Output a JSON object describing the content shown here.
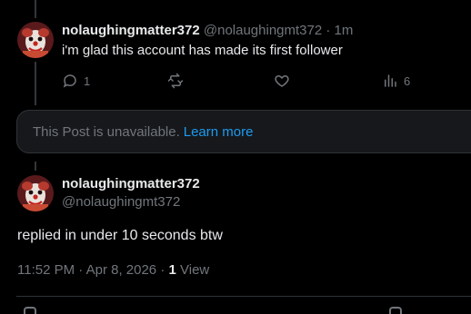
{
  "reply_tweet": {
    "display_name": "nolaughingmatter372",
    "handle": "@nolaughingmt372",
    "separator": "·",
    "time": "1m",
    "text": "i'm glad this account has made its first follower",
    "actions": {
      "reply": {
        "icon": "reply-icon",
        "count": "1"
      },
      "retweet": {
        "icon": "retweet-icon",
        "count": ""
      },
      "like": {
        "icon": "heart-icon",
        "count": ""
      },
      "views": {
        "icon": "views-chart-icon",
        "count": "6"
      }
    }
  },
  "quoted_post": {
    "message": "This Post is unavailable.",
    "link": "Learn more"
  },
  "main_tweet": {
    "display_name": "nolaughingmatter372",
    "handle": "@nolaughingmt372",
    "text": "replied in under 10 seconds btw",
    "timestamp": "11:52 PM · Apr 8, 2026",
    "separator": "·",
    "view_count": "1",
    "view_label": "View"
  },
  "colors": {
    "background": "#000000",
    "primary_text": "#e7e9ea",
    "secondary_text": "#71767b",
    "link": "#1d9bf0",
    "card_bg": "#16181c",
    "border": "#2f3336"
  }
}
